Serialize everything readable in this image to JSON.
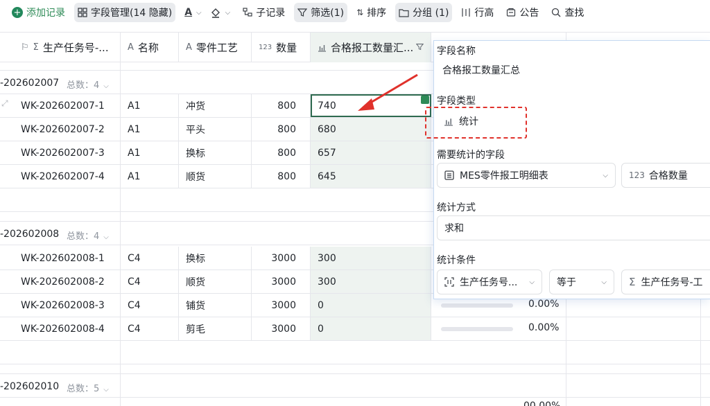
{
  "toolbar": {
    "add_record": "添加记录",
    "field_manage": "字段管理(14 隐藏)",
    "sub_record": "子记录",
    "filter": "筛选(1)",
    "sort": "排序",
    "group": "分组 (1)",
    "row_height": "行高",
    "notice": "公告",
    "search": "查找"
  },
  "table": {
    "headers": {
      "task_no": "生产任务号-...",
      "name": "名称",
      "process": "零件工艺",
      "qty": "数量",
      "summary": "合格报工数量汇..."
    },
    "groups": [
      {
        "name": "-202602007",
        "count": "总数：4",
        "rows": [
          {
            "task": "WK-202602007-1",
            "name": "A1",
            "process": "冲货",
            "qty": "800",
            "summary": "740"
          },
          {
            "task": "WK-202602007-2",
            "name": "A1",
            "process": "平头",
            "qty": "800",
            "summary": "680"
          },
          {
            "task": "WK-202602007-3",
            "name": "A1",
            "process": "换标",
            "qty": "800",
            "summary": "657"
          },
          {
            "task": "WK-202602007-4",
            "name": "A1",
            "process": "顺货",
            "qty": "800",
            "summary": "645"
          }
        ]
      },
      {
        "name": "-202602008",
        "count": "总数：4",
        "rows": [
          {
            "task": "WK-202602008-1",
            "name": "C4",
            "process": "换标",
            "qty": "3000",
            "summary": "300"
          },
          {
            "task": "WK-202602008-2",
            "name": "C4",
            "process": "顺货",
            "qty": "3000",
            "summary": "300"
          },
          {
            "task": "WK-202602008-3",
            "name": "C4",
            "process": "铺货",
            "qty": "3000",
            "summary": "0"
          },
          {
            "task": "WK-202602008-4",
            "name": "C4",
            "process": "剪毛",
            "qty": "3000",
            "summary": "0"
          }
        ]
      },
      {
        "name": "-202602010",
        "count": "总数：5",
        "rows": []
      }
    ],
    "percent_a": "0.00%",
    "percent_b": "0.00%",
    "percent_c": "00.00%"
  },
  "panel": {
    "field_name_label": "字段名称",
    "field_name_value": "合格报工数量汇总",
    "field_type_label": "字段类型",
    "field_type_value": "统计",
    "stat_field_label": "需要统计的字段",
    "stat_table": "MES零件报工明细表",
    "stat_field": "合格数量",
    "stat_field_prefix": "123",
    "method_label": "统计方式",
    "method_value": "求和",
    "condition_label": "统计条件",
    "cond_field": "生产任务号...",
    "cond_op": "等于",
    "cond_value": "生产任务号-工"
  },
  "icons": {
    "type_number": "123"
  },
  "colors": {
    "accent_green": "#22885c",
    "highlight_col": "#eef3f0",
    "annotation_red": "#e0312b"
  }
}
